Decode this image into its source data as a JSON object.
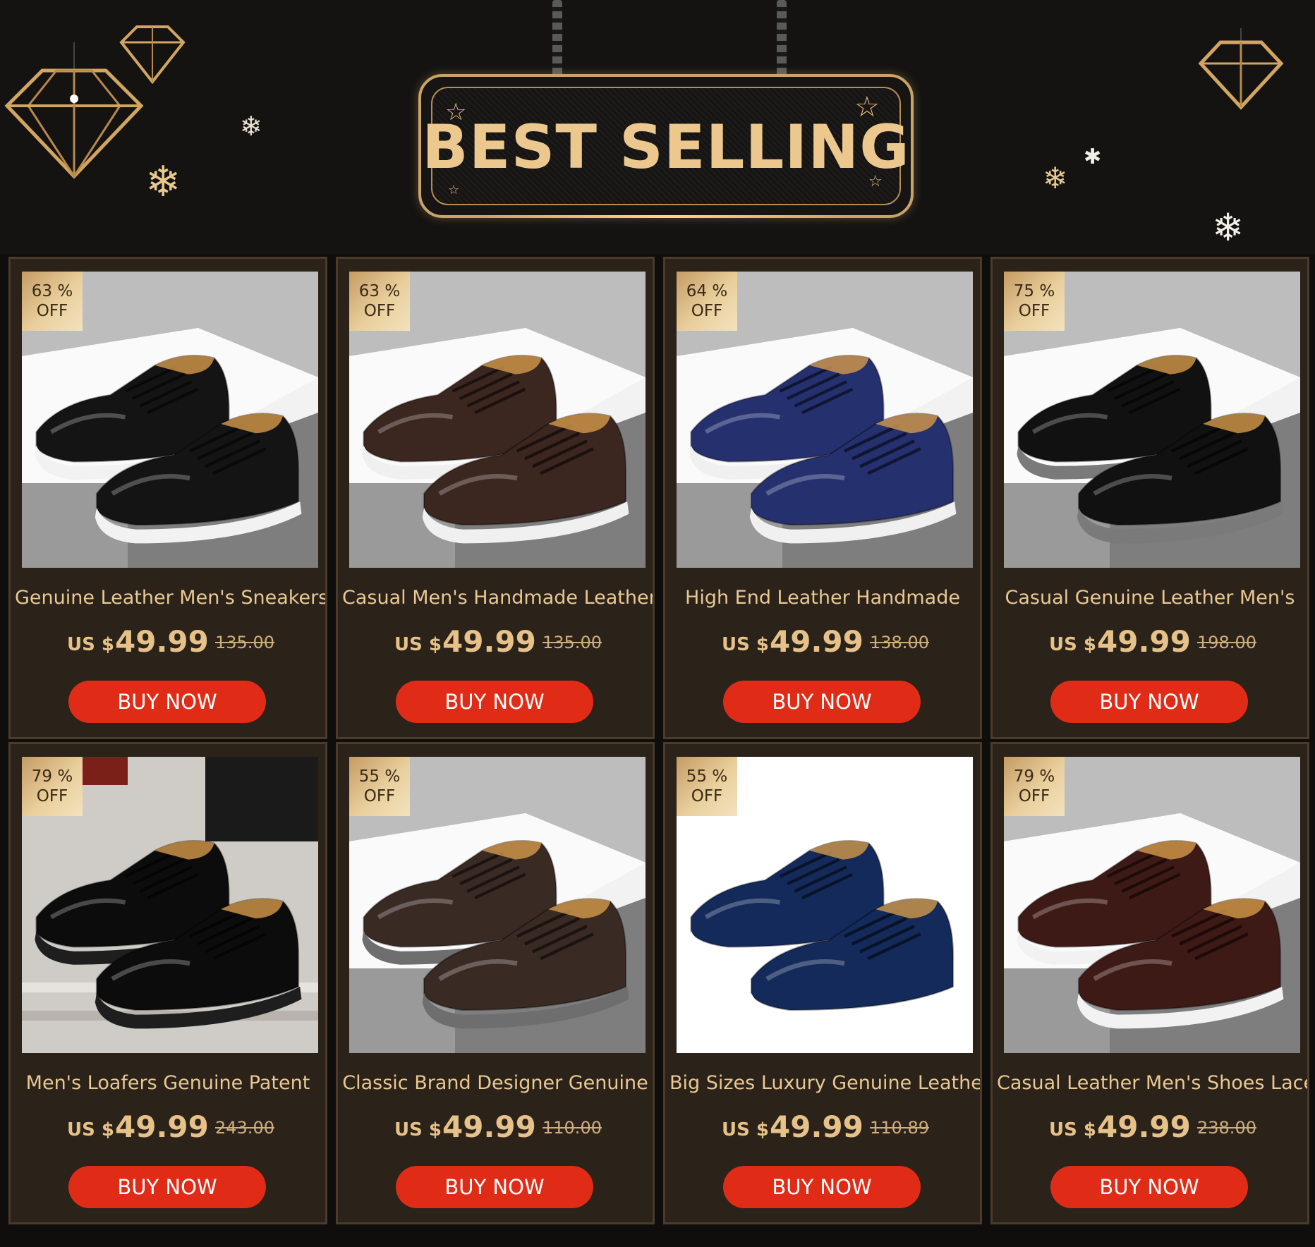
{
  "banner": {
    "title": "BEST SELLING"
  },
  "products": [
    {
      "discount_pct": "63 %",
      "discount_off": "OFF",
      "title": "Genuine Leather Men's Sneakers",
      "currency": "US $",
      "price": "49.99",
      "old_price": "135.00",
      "button": "BUY NOW",
      "shoe_color": "#141414",
      "sole_color": "#f2f2f2",
      "bg": "white-box"
    },
    {
      "discount_pct": "63 %",
      "discount_off": "OFF",
      "title": "Casual Men's Handmade Leather",
      "currency": "US $",
      "price": "49.99",
      "old_price": "135.00",
      "button": "BUY NOW",
      "shoe_color": "#3b2620",
      "sole_color": "#f0f0f0",
      "bg": "white-box"
    },
    {
      "discount_pct": "64 %",
      "discount_off": "OFF",
      "title": "High End Leather Handmade",
      "currency": "US $",
      "price": "49.99",
      "old_price": "138.00",
      "button": "BUY NOW",
      "shoe_color": "#25306e",
      "sole_color": "#f0f0f0",
      "bg": "white-box"
    },
    {
      "discount_pct": "75 %",
      "discount_off": "OFF",
      "title": "Casual Genuine Leather Men's",
      "currency": "US $",
      "price": "49.99",
      "old_price": "198.00",
      "button": "BUY NOW",
      "shoe_color": "#111111",
      "sole_color": "#7a7a7a",
      "bg": "white-box"
    },
    {
      "discount_pct": "79 %",
      "discount_off": "OFF",
      "title": "Men's Loafers Genuine Patent",
      "currency": "US $",
      "price": "49.99",
      "old_price": "243.00",
      "button": "BUY NOW",
      "shoe_color": "#0c0c0c",
      "sole_color": "#1e1e1e",
      "bg": "floor"
    },
    {
      "discount_pct": "55 %",
      "discount_off": "OFF",
      "title": "Classic Brand Designer Genuine",
      "currency": "US $",
      "price": "49.99",
      "old_price": "110.00",
      "button": "BUY NOW",
      "shoe_color": "#3a2a24",
      "sole_color": "#6e6e6e",
      "bg": "white-box"
    },
    {
      "discount_pct": "55 %",
      "discount_off": "OFF",
      "title": "Big Sizes Luxury Genuine Leather",
      "currency": "US $",
      "price": "49.99",
      "old_price": "110.89",
      "button": "BUY NOW",
      "shoe_color": "#132a5a",
      "sole_color": "#ffffff",
      "bg": "white"
    },
    {
      "discount_pct": "79 %",
      "discount_off": "OFF",
      "title": "Casual Leather Men's Shoes Lace",
      "currency": "US $",
      "price": "49.99",
      "old_price": "238.00",
      "button": "BUY NOW",
      "shoe_color": "#3e1a16",
      "sole_color": "#f2f2f2",
      "bg": "white-box"
    }
  ]
}
